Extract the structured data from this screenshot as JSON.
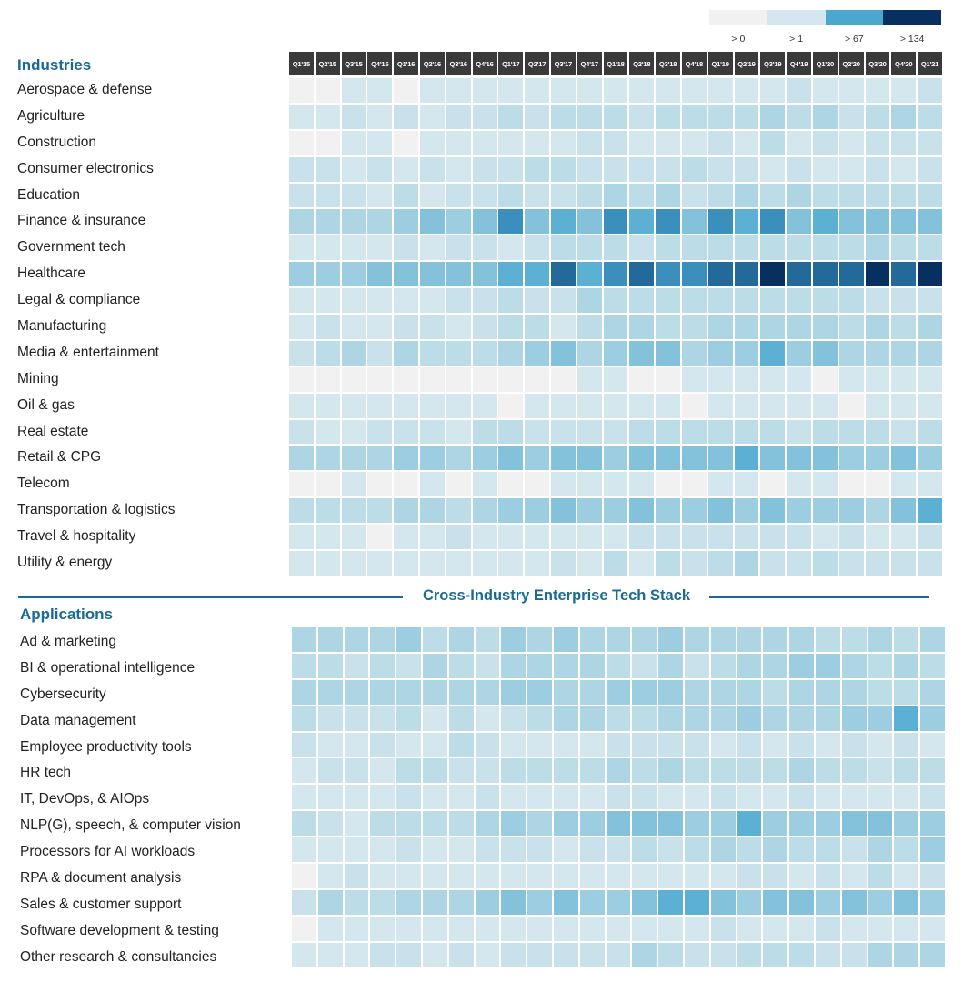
{
  "chart_data": {
    "type": "heatmap",
    "title": "Cross-Industry Enterprise Tech Stack",
    "value_scale_note": "Cell values are estimated color-intensity levels 0-10 (0 = lightest gray bin '> 0'; 10 = darkest navy bin '> 134')",
    "legend": {
      "placement": "top-right",
      "bins": [
        {
          "label": "> 0",
          "color": "#f1f1f1"
        },
        {
          "label": "> 1",
          "color": "#d4e6ee"
        },
        {
          "label": "> 67",
          "color": "#4aa8cf"
        },
        {
          "label": "> 134",
          "color": "#072f60"
        }
      ]
    },
    "columns": [
      "Q1'15",
      "Q2'15",
      "Q3'15",
      "Q4'15",
      "Q1'16",
      "Q2'16",
      "Q3'16",
      "Q4'16",
      "Q1'17",
      "Q2'17",
      "Q3'17",
      "Q4'17",
      "Q1'18",
      "Q2'18",
      "Q3'18",
      "Q4'18",
      "Q1'19",
      "Q2'19",
      "Q3'19",
      "Q4'19",
      "Q1'20",
      "Q2'20",
      "Q3'20",
      "Q4'20",
      "Q1'21"
    ],
    "sections": [
      {
        "title": "Industries",
        "rows": [
          {
            "label": "Aerospace & defense",
            "values": [
              0,
              0,
              1,
              1,
              0,
              1,
              1,
              1,
              1,
              1,
              1,
              1,
              1,
              1,
              1,
              1,
              1,
              1,
              1,
              2,
              1,
              1,
              1,
              1,
              2
            ]
          },
          {
            "label": "Agriculture",
            "values": [
              1,
              1,
              2,
              1,
              2,
              1,
              2,
              2,
              3,
              2,
              3,
              3,
              3,
              2,
              3,
              3,
              3,
              3,
              4,
              3,
              4,
              2,
              3,
              4,
              3
            ]
          },
          {
            "label": "Construction",
            "values": [
              0,
              0,
              1,
              1,
              0,
              1,
              1,
              1,
              1,
              1,
              1,
              2,
              2,
              1,
              1,
              1,
              2,
              1,
              3,
              1,
              2,
              1,
              2,
              2,
              2
            ]
          },
          {
            "label": "Consumer electronics",
            "values": [
              2,
              2,
              1,
              2,
              1,
              2,
              1,
              2,
              2,
              3,
              3,
              2,
              2,
              2,
              2,
              3,
              2,
              2,
              1,
              2,
              1,
              1,
              2,
              1,
              2
            ]
          },
          {
            "label": "Education",
            "values": [
              2,
              2,
              2,
              1,
              3,
              1,
              2,
              2,
              3,
              2,
              2,
              3,
              4,
              3,
              4,
              2,
              3,
              4,
              3,
              4,
              3,
              3,
              3,
              3,
              3
            ]
          },
          {
            "label": "Finance & insurance",
            "values": [
              4,
              4,
              4,
              4,
              5,
              6,
              5,
              6,
              8,
              6,
              7,
              6,
              8,
              7,
              8,
              6,
              8,
              7,
              8,
              6,
              7,
              6,
              6,
              6,
              6
            ]
          },
          {
            "label": "Government tech",
            "values": [
              1,
              1,
              1,
              1,
              2,
              1,
              2,
              2,
              1,
              2,
              3,
              3,
              3,
              2,
              3,
              3,
              3,
              3,
              3,
              3,
              3,
              3,
              4,
              3,
              3
            ]
          },
          {
            "label": "Healthcare",
            "values": [
              5,
              5,
              5,
              6,
              6,
              6,
              6,
              6,
              7,
              7,
              9,
              7,
              8,
              9,
              8,
              8,
              9,
              9,
              10,
              9,
              9,
              9,
              10,
              9,
              10
            ]
          },
          {
            "label": "Legal & compliance",
            "values": [
              1,
              1,
              1,
              1,
              1,
              1,
              2,
              2,
              3,
              2,
              2,
              4,
              3,
              3,
              3,
              3,
              3,
              3,
              3,
              3,
              3,
              3,
              2,
              2,
              2
            ]
          },
          {
            "label": "Manufacturing",
            "values": [
              1,
              2,
              1,
              1,
              2,
              2,
              1,
              2,
              3,
              3,
              1,
              3,
              4,
              4,
              3,
              3,
              4,
              4,
              4,
              4,
              4,
              3,
              4,
              3,
              4
            ]
          },
          {
            "label": "Media & entertainment",
            "values": [
              2,
              3,
              4,
              2,
              4,
              3,
              3,
              3,
              4,
              5,
              6,
              4,
              5,
              6,
              6,
              4,
              5,
              5,
              7,
              5,
              6,
              4,
              4,
              4,
              4
            ]
          },
          {
            "label": "Mining",
            "values": [
              0,
              0,
              0,
              0,
              0,
              0,
              0,
              0,
              0,
              0,
              0,
              1,
              1,
              0,
              0,
              1,
              1,
              1,
              1,
              1,
              0,
              1,
              1,
              1,
              1
            ]
          },
          {
            "label": "Oil & gas",
            "values": [
              1,
              1,
              1,
              1,
              1,
              1,
              1,
              1,
              0,
              1,
              1,
              1,
              1,
              1,
              1,
              0,
              1,
              1,
              1,
              1,
              1,
              0,
              1,
              1,
              1
            ]
          },
          {
            "label": "Real estate",
            "values": [
              2,
              1,
              1,
              2,
              2,
              2,
              1,
              3,
              3,
              2,
              2,
              2,
              2,
              3,
              3,
              3,
              3,
              3,
              3,
              2,
              3,
              3,
              3,
              2,
              3
            ]
          },
          {
            "label": "Retail & CPG",
            "values": [
              4,
              4,
              4,
              4,
              5,
              5,
              4,
              5,
              6,
              5,
              6,
              6,
              5,
              6,
              6,
              6,
              6,
              7,
              6,
              6,
              6,
              5,
              5,
              6,
              5
            ]
          },
          {
            "label": "Telecom",
            "values": [
              0,
              0,
              1,
              0,
              0,
              1,
              0,
              1,
              0,
              0,
              1,
              1,
              1,
              1,
              0,
              0,
              1,
              1,
              0,
              1,
              1,
              0,
              0,
              1,
              1
            ]
          },
          {
            "label": "Transportation & logistics",
            "values": [
              3,
              3,
              3,
              3,
              4,
              4,
              3,
              4,
              5,
              5,
              6,
              5,
              5,
              6,
              5,
              5,
              6,
              5,
              6,
              5,
              5,
              5,
              4,
              6,
              7
            ]
          },
          {
            "label": "Travel & hospitality",
            "values": [
              1,
              1,
              1,
              0,
              1,
              1,
              2,
              1,
              1,
              1,
              1,
              1,
              1,
              2,
              2,
              2,
              2,
              2,
              2,
              2,
              1,
              2,
              1,
              1,
              2
            ]
          },
          {
            "label": "Utility & energy",
            "values": [
              1,
              1,
              1,
              1,
              1,
              1,
              1,
              1,
              1,
              1,
              2,
              1,
              3,
              1,
              3,
              2,
              3,
              4,
              2,
              2,
              3,
              2,
              2,
              2,
              2
            ]
          }
        ]
      },
      {
        "title": "Applications",
        "rows": [
          {
            "label": "Ad & marketing",
            "values": [
              4,
              4,
              4,
              4,
              5,
              3,
              4,
              3,
              5,
              4,
              5,
              4,
              4,
              4,
              5,
              4,
              4,
              4,
              4,
              4,
              3,
              3,
              4,
              3,
              4
            ]
          },
          {
            "label": "BI & operational intelligence",
            "values": [
              3,
              3,
              2,
              3,
              2,
              4,
              3,
              2,
              4,
              4,
              4,
              4,
              3,
              2,
              4,
              2,
              3,
              4,
              4,
              5,
              5,
              4,
              3,
              4,
              3
            ]
          },
          {
            "label": "Cybersecurity",
            "values": [
              4,
              4,
              4,
              4,
              4,
              4,
              4,
              4,
              5,
              5,
              4,
              4,
              5,
              5,
              5,
              4,
              4,
              4,
              3,
              4,
              4,
              4,
              3,
              3,
              4
            ]
          },
          {
            "label": "Data management",
            "values": [
              3,
              2,
              2,
              2,
              3,
              1,
              3,
              1,
              2,
              3,
              4,
              4,
              3,
              3,
              4,
              4,
              4,
              5,
              4,
              4,
              4,
              5,
              5,
              7,
              5
            ]
          },
          {
            "label": "Employee productivity tools",
            "values": [
              2,
              1,
              1,
              2,
              1,
              1,
              3,
              2,
              1,
              1,
              1,
              1,
              2,
              2,
              2,
              2,
              1,
              2,
              1,
              2,
              1,
              2,
              1,
              2,
              1
            ]
          },
          {
            "label": "HR tech",
            "values": [
              1,
              2,
              2,
              1,
              3,
              3,
              2,
              2,
              3,
              3,
              3,
              3,
              4,
              3,
              4,
              3,
              3,
              3,
              3,
              4,
              3,
              3,
              2,
              3,
              3
            ]
          },
          {
            "label": "IT, DevOps, & AIOps",
            "values": [
              1,
              1,
              1,
              1,
              2,
              1,
              1,
              2,
              1,
              1,
              1,
              1,
              2,
              2,
              1,
              1,
              2,
              1,
              1,
              2,
              1,
              1,
              1,
              1,
              2
            ]
          },
          {
            "label": "NLP(G), speech, & computer vision",
            "values": [
              3,
              2,
              1,
              3,
              3,
              3,
              3,
              4,
              5,
              4,
              5,
              5,
              6,
              6,
              6,
              5,
              5,
              7,
              5,
              5,
              5,
              6,
              6,
              5,
              5
            ]
          },
          {
            "label": "Processors for AI workloads",
            "values": [
              1,
              1,
              1,
              1,
              2,
              1,
              1,
              2,
              2,
              2,
              1,
              2,
              2,
              3,
              2,
              3,
              4,
              3,
              4,
              3,
              3,
              2,
              4,
              3,
              5
            ]
          },
          {
            "label": "RPA &  document analysis",
            "values": [
              0,
              1,
              2,
              1,
              1,
              1,
              1,
              1,
              1,
              1,
              1,
              1,
              1,
              1,
              1,
              1,
              1,
              2,
              2,
              1,
              2,
              1,
              3,
              1,
              2
            ]
          },
          {
            "label": "Sales & customer support",
            "values": [
              2,
              4,
              3,
              3,
              4,
              4,
              4,
              5,
              6,
              5,
              6,
              5,
              5,
              6,
              7,
              7,
              6,
              5,
              6,
              6,
              5,
              6,
              5,
              6,
              5
            ]
          },
          {
            "label": "Software development & testing",
            "values": [
              0,
              1,
              1,
              1,
              1,
              1,
              1,
              1,
              1,
              1,
              1,
              1,
              1,
              1,
              1,
              1,
              2,
              1,
              1,
              1,
              2,
              1,
              1,
              1,
              1
            ]
          },
          {
            "label": "Other research & consultancies",
            "values": [
              1,
              1,
              1,
              2,
              2,
              1,
              2,
              1,
              2,
              2,
              2,
              2,
              2,
              4,
              3,
              2,
              2,
              3,
              3,
              3,
              2,
              2,
              4,
              4,
              4
            ]
          }
        ]
      }
    ]
  }
}
